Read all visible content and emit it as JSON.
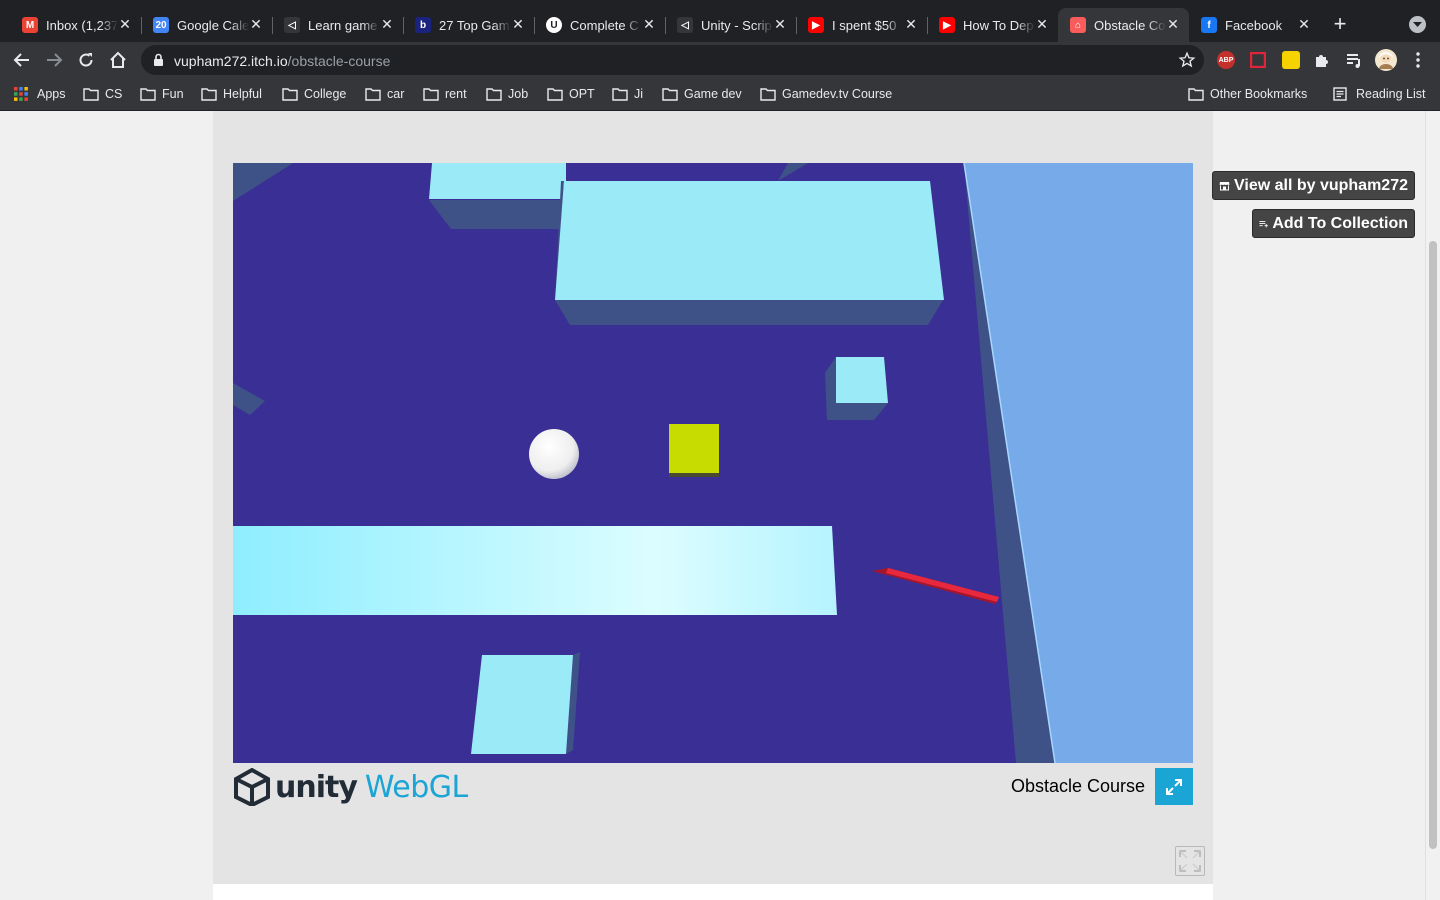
{
  "browser": {
    "tabs": [
      {
        "title": "Inbox (1,237",
        "icon": "gmail-icon",
        "color": "#ea4335",
        "glyph": "M",
        "active": false
      },
      {
        "title": "Google Cale",
        "icon": "calendar-icon",
        "color": "#4285f4",
        "glyph": "20",
        "active": false
      },
      {
        "title": "Learn game",
        "icon": "gamedev-icon",
        "color": "#35363a",
        "glyph": "◁",
        "active": false
      },
      {
        "title": "27 Top Gam",
        "icon": "b-site-icon",
        "color": "#1a237e",
        "glyph": "b",
        "active": false
      },
      {
        "title": "Complete C",
        "icon": "udemy-icon",
        "color": "#ffffff",
        "glyph": "U",
        "active": false
      },
      {
        "title": "Unity - Scrip",
        "icon": "unity-icon",
        "color": "#35363a",
        "glyph": "◁",
        "active": false
      },
      {
        "title": "I spent $50",
        "icon": "youtube-icon",
        "color": "#ff0000",
        "glyph": "▶",
        "active": false
      },
      {
        "title": "How To Dep",
        "icon": "youtube-icon",
        "color": "#ff0000",
        "glyph": "▶",
        "active": false
      },
      {
        "title": "Obstacle Co",
        "icon": "itch-icon",
        "color": "#fa5c5c",
        "glyph": "⌂",
        "active": true
      },
      {
        "title": "Facebook",
        "icon": "facebook-icon",
        "color": "#1877f2",
        "glyph": "f",
        "active": false
      }
    ],
    "url_host": "vupham272.itch.io",
    "url_path": "/obstacle-course",
    "bookmarks": [
      "Apps",
      "CS",
      "Fun",
      "Helpful",
      "College",
      "car",
      "rent",
      "Job",
      "OPT",
      "Ji",
      "Game dev",
      "Gamedev.tv Course"
    ],
    "other_bookmarks": "Other Bookmarks",
    "reading_list": "Reading List",
    "extension_abp": "ABP"
  },
  "itch": {
    "view_all": "View all by vupham272",
    "add_collection": "Add To Collection"
  },
  "unity": {
    "logo_word": "unity",
    "webgl_word": "WebGL",
    "build_title": "Obstacle Course"
  },
  "colors": {
    "floor": "#3a2f94",
    "obstacle": "#a0eeff",
    "player": "#ffffff",
    "goal_block": "#c7dc00",
    "spinner": "#e8283c",
    "wall": "#76aae8",
    "unity_blue": "#1aa5d5"
  }
}
